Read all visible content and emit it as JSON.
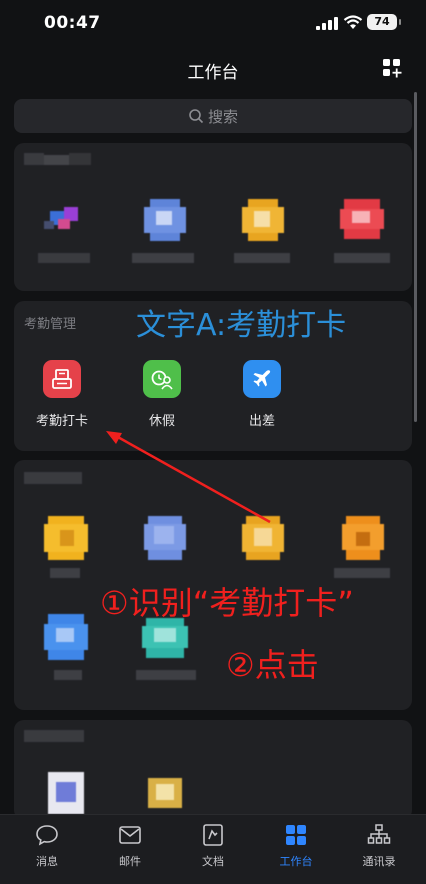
{
  "status": {
    "time": "00:47",
    "battery": "74"
  },
  "header": {
    "title": "工作台",
    "add_icon": "grid-plus-icon"
  },
  "search": {
    "placeholder": "搜索"
  },
  "attendance": {
    "title": "考勤管理",
    "apps": [
      {
        "label": "考勤打卡",
        "icon": "clock-in-icon",
        "color": "#e5424a"
      },
      {
        "label": "休假",
        "icon": "leave-icon",
        "color": "#4fbf4a"
      },
      {
        "label": "出差",
        "icon": "airplane-icon",
        "color": "#2f8ff0"
      }
    ]
  },
  "annotations": {
    "blue": "文字A:考勤打卡",
    "red1": "①识别“考勤打卡”",
    "red2": "②点击"
  },
  "tabbar": {
    "items": [
      {
        "label": "消息",
        "icon": "message-icon"
      },
      {
        "label": "邮件",
        "icon": "mail-icon"
      },
      {
        "label": "文档",
        "icon": "document-icon"
      },
      {
        "label": "工作台",
        "icon": "workbench-icon",
        "active": true
      },
      {
        "label": "通讯录",
        "icon": "contacts-icon"
      }
    ]
  },
  "colors": {
    "accent": "#2f86ff",
    "annotation_red": "#f0201e",
    "annotation_blue": "#2b8fd8"
  }
}
